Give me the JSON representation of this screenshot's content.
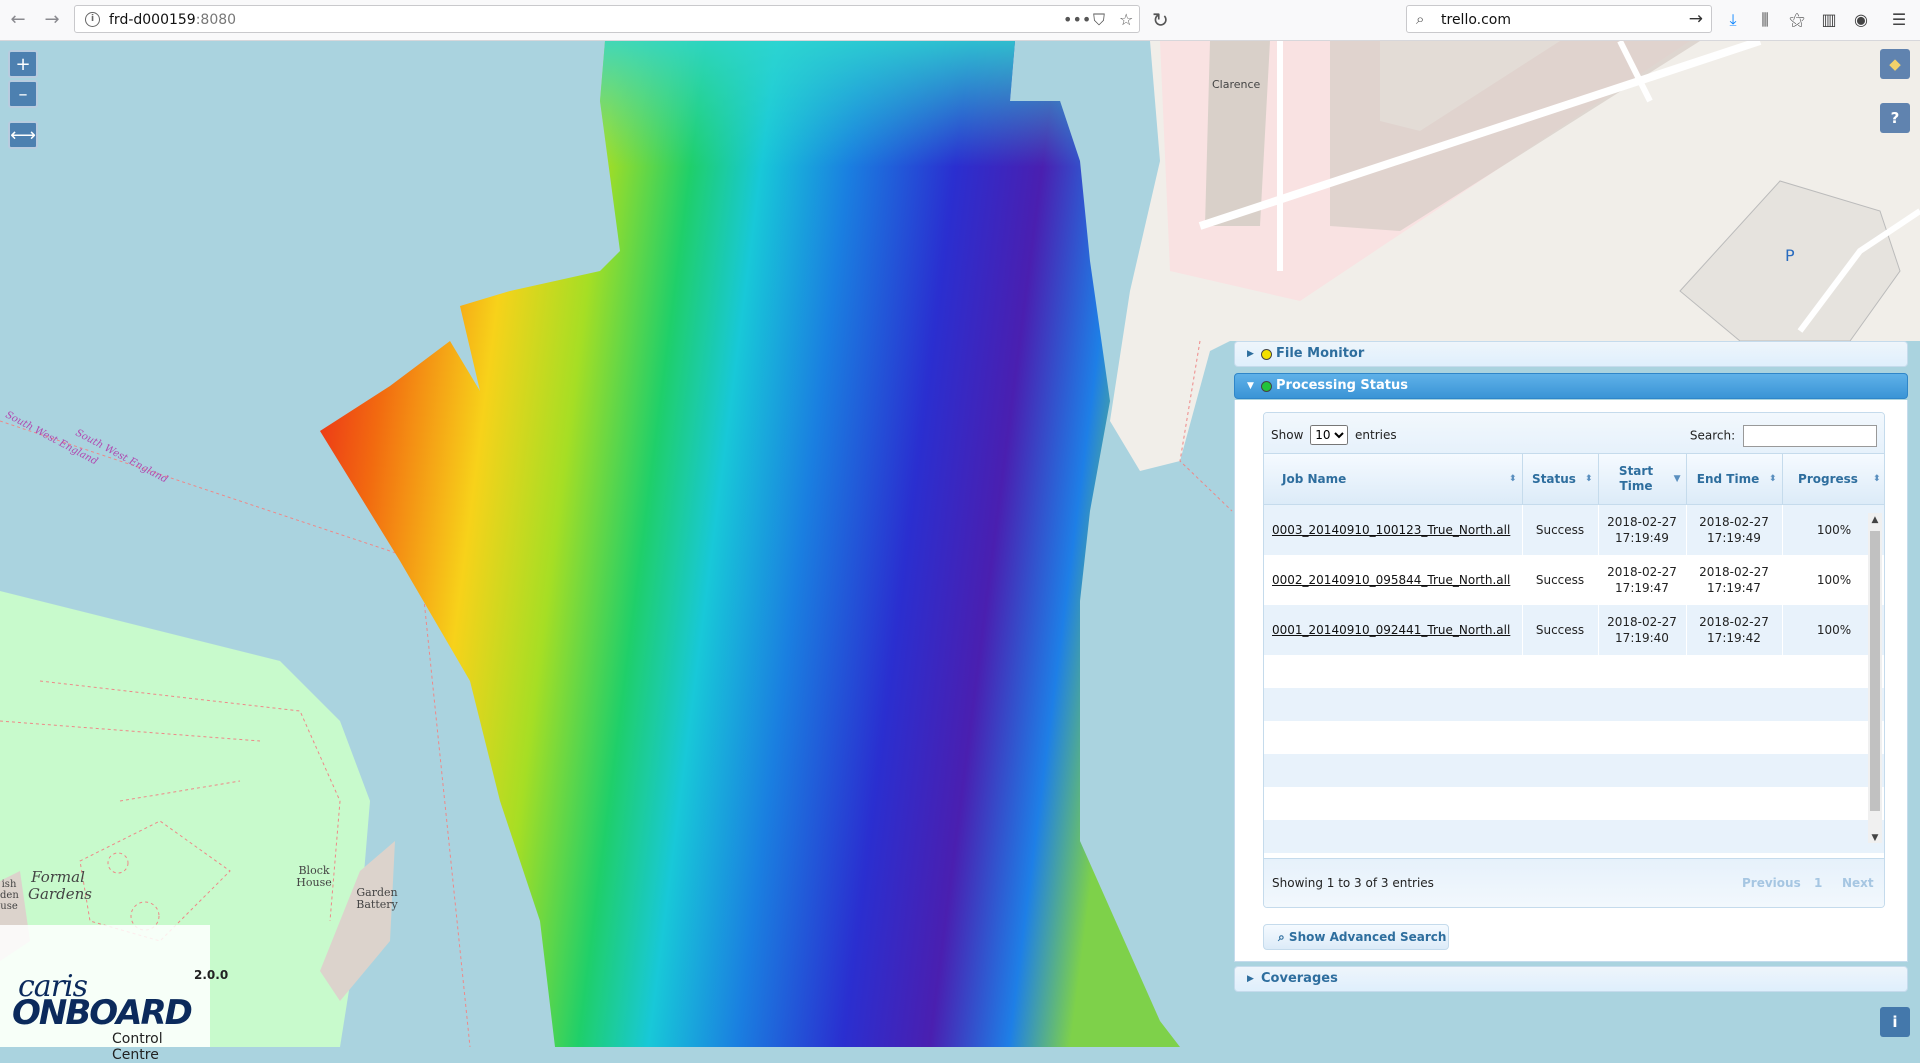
{
  "browser": {
    "url_host": "frd-d000159",
    "url_port": ":8080",
    "search_value": "trello.com"
  },
  "map": {
    "labels": {
      "clarence": "Clarence",
      "parking": "P",
      "region1": "South West England",
      "region2": "South West England",
      "formal_gardens": "Formal Gardens",
      "block_house": "Block House",
      "garden_battery": "Garden Battery",
      "partial_left": "ish den use"
    },
    "controls": {
      "zoom_in": "+",
      "zoom_out": "–",
      "extent": "⟷",
      "layers": "◆",
      "help": "?",
      "info": "i"
    }
  },
  "logo": {
    "line1": "caris",
    "line2": "ONBOARD",
    "version": "2.0.0",
    "subtitle": "Control Centre"
  },
  "panel": {
    "sections": [
      {
        "label": "File Monitor",
        "status_color": "#f2e000"
      },
      {
        "label": "Processing Status",
        "status_color": "#22c33a"
      },
      {
        "label": "Coverages"
      }
    ],
    "table": {
      "show_label": "Show",
      "entries_label": "entries",
      "page_size": "10",
      "search_label": "Search:",
      "columns": [
        "Job Name",
        "Status",
        "Start Time",
        "End Time",
        "Progress"
      ],
      "rows": [
        {
          "job": "0003_20140910_100123_True_North.all",
          "status": "Success",
          "start_date": "2018-02-27",
          "start_time": "17:19:49",
          "end_date": "2018-02-27",
          "end_time": "17:19:49",
          "progress": "100%"
        },
        {
          "job": "0002_20140910_095844_True_North.all",
          "status": "Success",
          "start_date": "2018-02-27",
          "start_time": "17:19:47",
          "end_date": "2018-02-27",
          "end_time": "17:19:47",
          "progress": "100%"
        },
        {
          "job": "0001_20140910_092441_True_North.all",
          "status": "Success",
          "start_date": "2018-02-27",
          "start_time": "17:19:40",
          "end_date": "2018-02-27",
          "end_time": "17:19:42",
          "progress": "100%"
        }
      ],
      "info": "Showing 1 to 3 of 3 entries",
      "prev": "Previous",
      "page": "1",
      "next": "Next"
    },
    "advanced_search": "Show Advanced Search"
  }
}
